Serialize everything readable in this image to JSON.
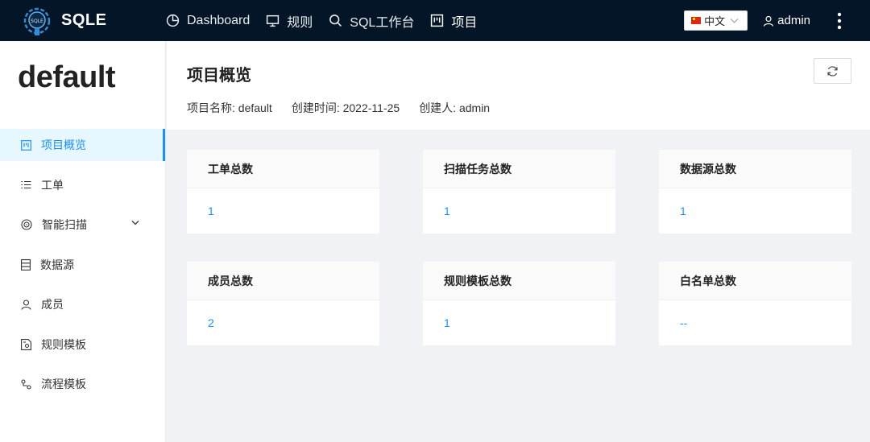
{
  "header": {
    "logo_text": "SQLE",
    "nav": [
      {
        "label": "Dashboard",
        "icon": "pie-chart-icon"
      },
      {
        "label": "规则",
        "icon": "desktop-icon"
      },
      {
        "label": "SQL工作台",
        "icon": "search-icon"
      },
      {
        "label": "项目",
        "icon": "project-icon"
      }
    ],
    "language": "中文",
    "user": "admin"
  },
  "sidebar": {
    "project_name": "default",
    "items": [
      {
        "label": "项目概览",
        "icon": "project-icon",
        "active": true
      },
      {
        "label": "工单",
        "icon": "list-icon"
      },
      {
        "label": "智能扫描",
        "icon": "scan-icon",
        "expandable": true
      },
      {
        "label": "数据源",
        "icon": "database-icon"
      },
      {
        "label": "成员",
        "icon": "user-icon"
      },
      {
        "label": "规则模板",
        "icon": "template-icon"
      },
      {
        "label": "流程模板",
        "icon": "flow-icon"
      }
    ]
  },
  "page": {
    "title": "项目概览",
    "project_name_label": "项目名称: default",
    "created_time_label": "创建时间: 2022-11-25",
    "creator_label": "创建人: admin"
  },
  "cards": [
    {
      "title": "工单总数",
      "value": "1"
    },
    {
      "title": "扫描任务总数",
      "value": "1"
    },
    {
      "title": "数据源总数",
      "value": "1"
    },
    {
      "title": "成员总数",
      "value": "2"
    },
    {
      "title": "规则模板总数",
      "value": "1"
    },
    {
      "title": "白名单总数",
      "value": "--"
    }
  ],
  "colors": {
    "header_bg": "#041527",
    "accent": "#1890ff",
    "active_bg": "#e6f7ff"
  }
}
